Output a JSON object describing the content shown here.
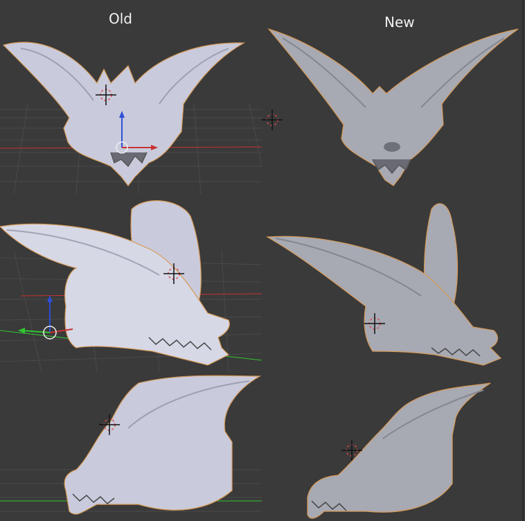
{
  "labels": {
    "old": "Old",
    "new": "New"
  },
  "colors": {
    "background": "#3a3a3a",
    "grid": "#4a4a4a",
    "axis_x": "#c83232",
    "axis_y": "#32c832",
    "axis_z": "#2e4fd6",
    "mesh_old": "#c9cbdc",
    "mesh_new": "#a7a9b3",
    "outline": "#d79a56",
    "cursor": "#111111",
    "cursor_ring": "#d84a4a"
  },
  "icons": {
    "cursor": "3d-cursor-icon",
    "pivot": "object-origin-icon",
    "manipulator": "transform-manipulator-icon"
  }
}
